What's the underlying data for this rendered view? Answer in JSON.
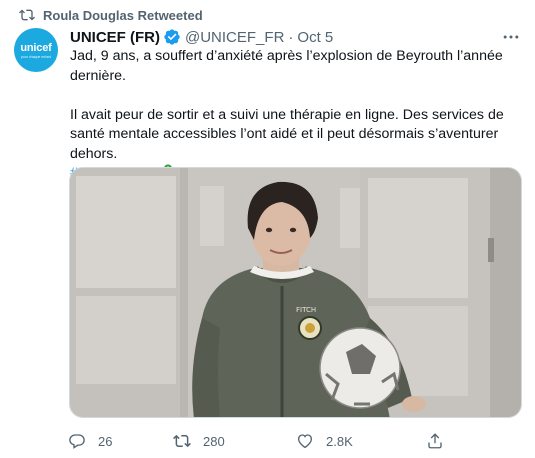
{
  "retweet": {
    "text": "Roula Douglas Retweeted"
  },
  "author": {
    "name": "UNICEF (FR)",
    "handle": "@UNICEF_FR",
    "separator": "·",
    "date": "Oct 5",
    "avatar_word": "unicef",
    "avatar_sub": "pour chaque enfant"
  },
  "tweet": {
    "line1": "Jad, 9 ans, a souffert d’anxiété après l’explosion de Beyrouth l’année dernière.",
    "line2": "Il avait peur de sortir et a suivi une thérapie en ligne. Des services de santé mentale accessibles l’ont aidé et il peut désormais s’aventurer dehors.",
    "hashtag": "#DansMaTête"
  },
  "media": {
    "shirt_text": "FITCH"
  },
  "actions": {
    "replies": "26",
    "retweets": "280",
    "likes": "2.8K"
  },
  "colors": {
    "accent": "#1d9bf0",
    "secondary_text": "#536471",
    "unicef_blue": "#1ca9e0",
    "ribbon": "#2e9e3a"
  }
}
